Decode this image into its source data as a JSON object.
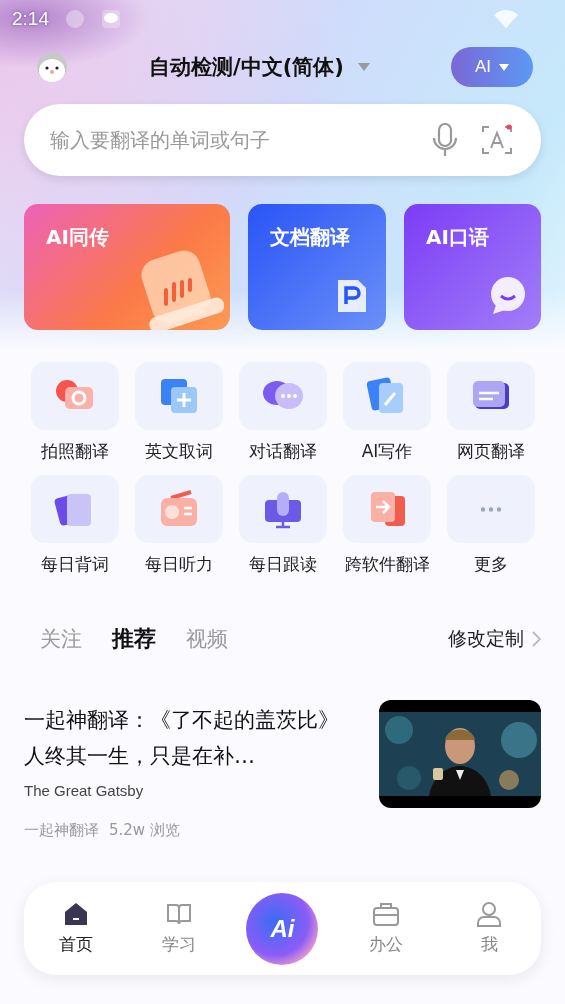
{
  "status_bar": {
    "time": "2:14"
  },
  "header": {
    "language": "自动检测/中文(简体)",
    "ai_button": "AI"
  },
  "search": {
    "placeholder": "输入要翻译的单词或句子",
    "scan_badge": true
  },
  "feature_cards": [
    {
      "label": "AI同传",
      "kind": "live"
    },
    {
      "label": "文档翻译",
      "kind": "document"
    },
    {
      "label": "AI口语",
      "kind": "speaking"
    }
  ],
  "tools": [
    {
      "label": "拍照翻译"
    },
    {
      "label": "英文取词"
    },
    {
      "label": "对话翻译"
    },
    {
      "label": "AI写作"
    },
    {
      "label": "网页翻译"
    },
    {
      "label": "每日背词"
    },
    {
      "label": "每日听力"
    },
    {
      "label": "每日跟读"
    },
    {
      "label": "跨软件翻译"
    },
    {
      "label": "更多"
    }
  ],
  "feed_tabs": [
    {
      "label": "关注",
      "selected": false
    },
    {
      "label": "推荐",
      "selected": true
    },
    {
      "label": "视频",
      "selected": false
    }
  ],
  "customize": "修改定制",
  "articles": [
    {
      "title": "一起神翻译：《了不起的盖茨比》人终其一生，只是在补…",
      "subtitle": "The Great Gatsby",
      "source": "一起神翻译",
      "views": "5.2w 浏览",
      "kind": "picture"
    }
  ],
  "bottom_nav": [
    {
      "label": "首页",
      "selected": true
    },
    {
      "label": "学习",
      "selected": false
    },
    {
      "label": "Ai",
      "kind": "ai"
    },
    {
      "label": "办公",
      "selected": false
    },
    {
      "label": "我",
      "selected": false
    }
  ]
}
